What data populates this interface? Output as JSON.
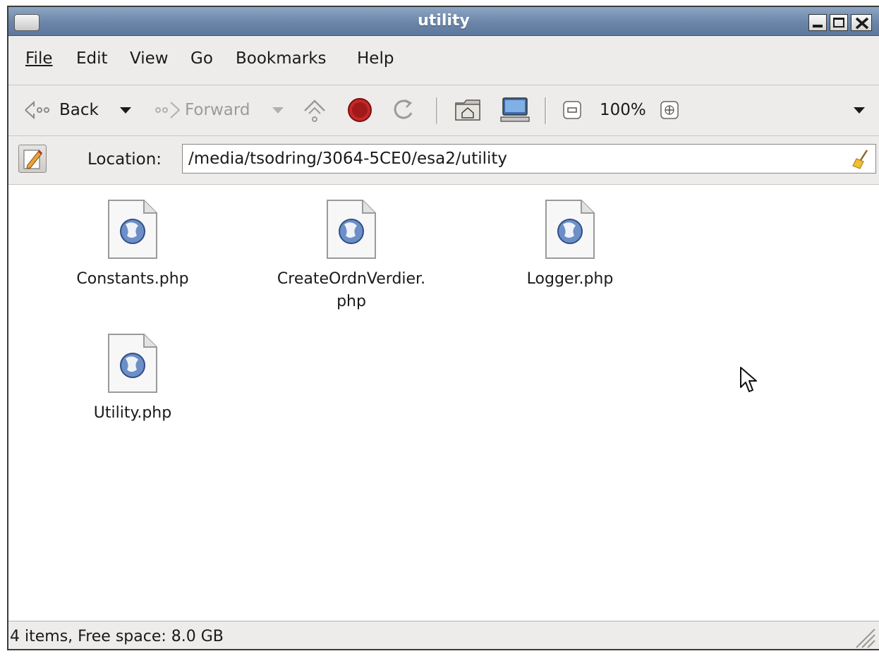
{
  "window": {
    "title": "utility"
  },
  "menubar": {
    "items": [
      {
        "label": "File"
      },
      {
        "label": "Edit"
      },
      {
        "label": "View"
      },
      {
        "label": "Go"
      },
      {
        "label": "Bookmarks"
      },
      {
        "label": "Help"
      }
    ]
  },
  "toolbar": {
    "back_label": "Back",
    "forward_label": "Forward",
    "zoom_level": "100%"
  },
  "location": {
    "label": "Location:",
    "path": "/media/tsodring/3064-5CE0/esa2/utility"
  },
  "files": [
    {
      "name_line1": "Constants.php",
      "name_line2": "",
      "icon": "php-web-file-icon"
    },
    {
      "name_line1": "CreateOrdnVerdier.",
      "name_line2": "php",
      "icon": "php-web-file-icon"
    },
    {
      "name_line1": "Logger.php",
      "name_line2": "",
      "icon": "php-web-file-icon"
    },
    {
      "name_line1": "Utility.php",
      "name_line2": "",
      "icon": "php-web-file-icon"
    }
  ],
  "status": {
    "text": "4 items, Free space: 8.0 GB"
  }
}
